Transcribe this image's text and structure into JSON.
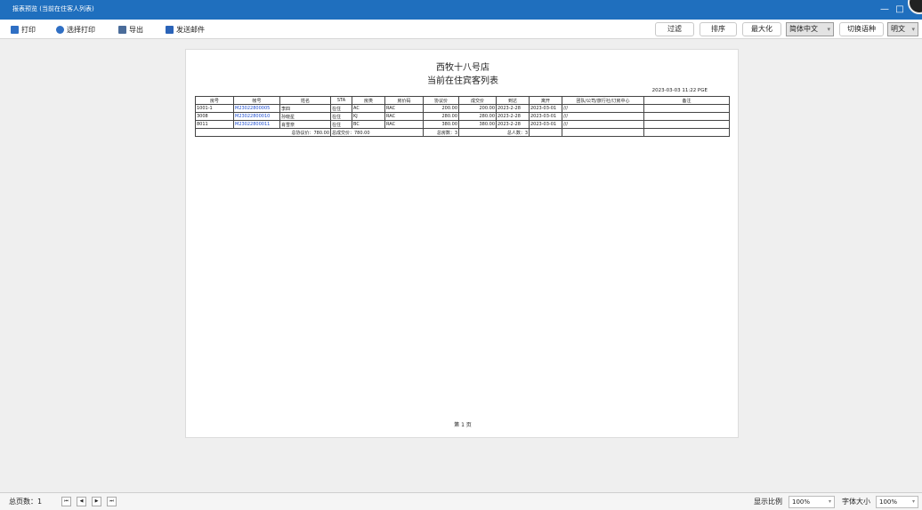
{
  "window": {
    "title": "报表预览 (当前在住客人列表)",
    "minimize": "—",
    "maximize": "□"
  },
  "toolbar": {
    "print": "打印",
    "select_print": "选择打印",
    "export": "导出",
    "send_mail": "发送邮件",
    "filter": "过滤",
    "sort": "排序",
    "maximize": "最大化",
    "language_value": "简体中文",
    "switch_language": "切换语种",
    "font_value": "明文"
  },
  "report": {
    "hotel": "西牧十八号店",
    "title": "当前在住宾客列表",
    "timestamp": "2023-03-03 11:22  PGE",
    "headers": [
      "房号",
      "帐号",
      "姓名",
      "STA",
      "房类",
      "房价码",
      "协议价",
      "成交价",
      "到达",
      "离开",
      "团队/公司/旅行社/订房中心",
      "备注"
    ],
    "rows": [
      [
        "1001-1",
        "M23022800005",
        "李四",
        "在住",
        "AC",
        "RAC",
        "200.00",
        "200.00",
        "2023-2-28",
        "2023-03-01",
        "///",
        ""
      ],
      [
        "3008",
        "M23022800010",
        "孙晓星",
        "在住",
        "KJ",
        "RAC",
        "280.00",
        "280.00",
        "2023-2-28",
        "2023-03-01",
        "///",
        ""
      ],
      [
        "8011",
        "M23022800011",
        "肖雪奈",
        "在住",
        "BC",
        "RAC",
        "380.00",
        "380.00",
        "2023-2-28",
        "2023-03-01",
        "///",
        ""
      ]
    ],
    "summary": {
      "total_agreed": "总协议价：780.00",
      "total_deal": "总成交价：780.00",
      "total_rooms": "总房数：3",
      "total_people": "总人数：3"
    },
    "page": "第 1 页"
  },
  "status": {
    "total_pages": "总页数：1",
    "first": "⏮",
    "prev": "◀",
    "next": "▶",
    "last": "⏭",
    "zoom_label": "显示比例",
    "zoom_value": "100%",
    "font_size_label": "字体大小",
    "font_size_value": "100%"
  },
  "colors": {
    "titlebar": "#1f6fbe",
    "link": "#1f4fd0",
    "background": "#efefef"
  },
  "icons": {
    "print": "printer-icon",
    "select_print": "select-print-icon",
    "export": "export-icon",
    "send_mail": "mail-icon"
  }
}
